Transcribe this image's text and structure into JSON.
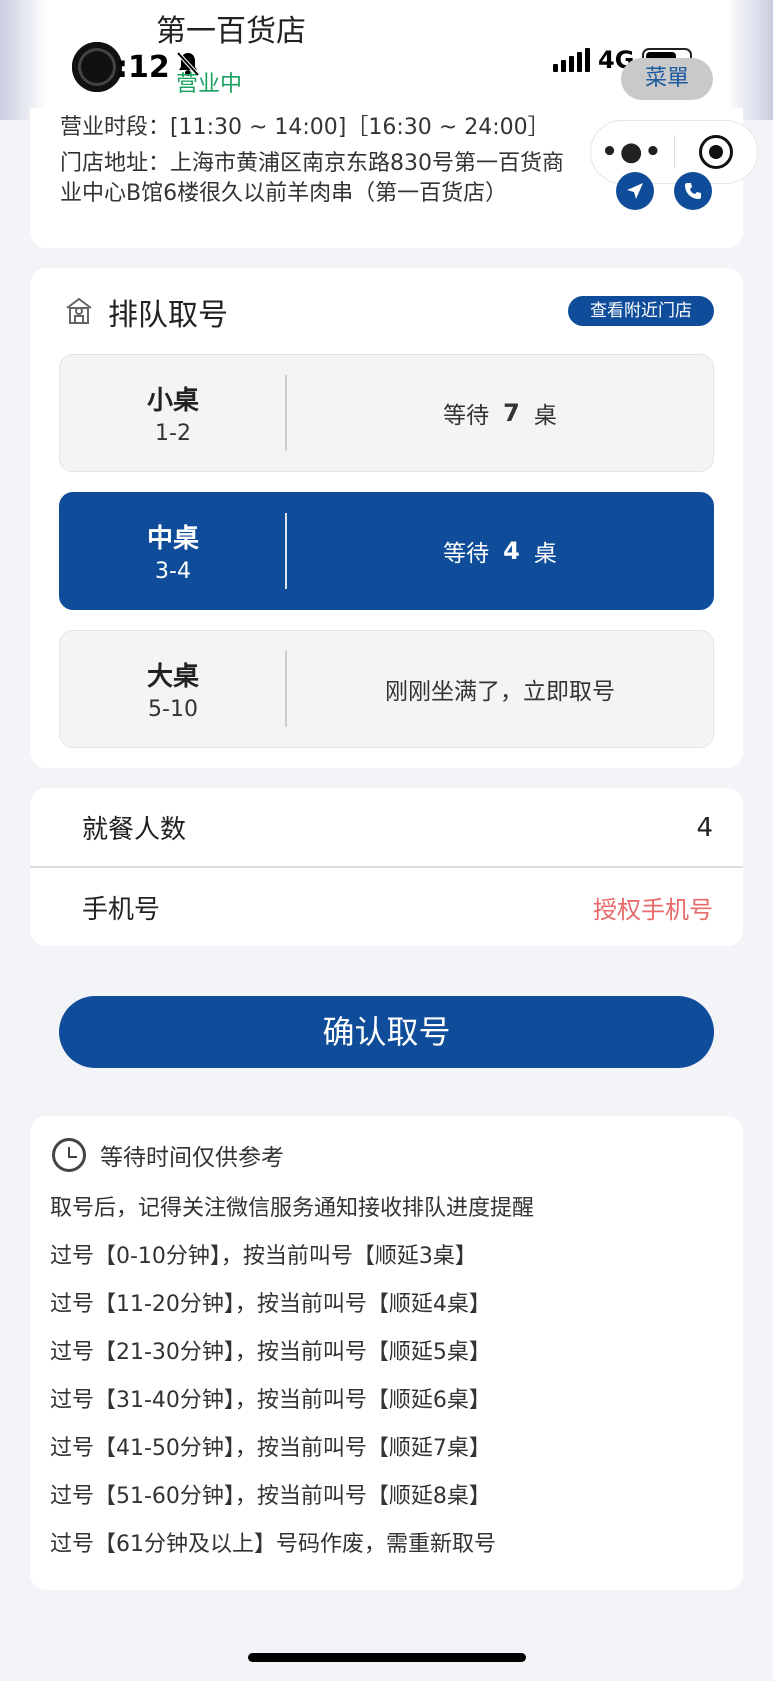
{
  "status_bar": {
    "time": ":12",
    "network": "4G"
  },
  "header": {
    "store_name": "第一百货店",
    "open_status": "营业中",
    "menu_label": "菜單"
  },
  "store_info": {
    "hours": "营业时段：[11:30 ~ 14:00]［16:30 ~ 24:00］",
    "address_line1": "门店地址：上海市黄浦区南京东路830号第一百货商",
    "address_line2": "业中心B馆6楼很久以前羊肉串（第一百货店）"
  },
  "queue": {
    "title": "排队取号",
    "nearby_button": "查看附近门店",
    "options": [
      {
        "name": "小桌",
        "range": "1-2",
        "wait_prefix": "等待",
        "wait_count": "7",
        "wait_suffix": "桌",
        "selected": false
      },
      {
        "name": "中桌",
        "range": "3-4",
        "wait_prefix": "等待",
        "wait_count": "4",
        "wait_suffix": "桌",
        "selected": true
      },
      {
        "name": "大桌",
        "range": "5-10",
        "status": "刚刚坐满了，立即取号",
        "selected": false
      }
    ]
  },
  "form": {
    "diners_label": "就餐人数",
    "diners_value": "4",
    "phone_label": "手机号",
    "phone_action": "授权手机号"
  },
  "confirm_button": "确认取号",
  "notes": {
    "title": "等待时间仅供参考",
    "lines": [
      "取号后，记得关注微信服务通知接收排队进度提醒",
      "过号【0-10分钟】，按当前叫号【顺延3桌】",
      "过号【11-20分钟】，按当前叫号【顺延4桌】",
      "过号【21-30分钟】，按当前叫号【顺延5桌】",
      "过号【31-40分钟】，按当前叫号【顺延6桌】",
      "过号【41-50分钟】，按当前叫号【顺延7桌】",
      "过号【51-60分钟】，按当前叫号【顺延8桌】",
      "过号【61分钟及以上】号码作废，需重新取号"
    ]
  },
  "colors": {
    "primary": "#0f4d9a",
    "open_green": "#1aa260",
    "auth_red": "#e86a6a"
  },
  "icons": [
    "more-dots-icon",
    "target-icon",
    "navigation-arrow-icon",
    "phone-icon",
    "store-icon",
    "clock-icon",
    "bell-off-icon",
    "signal-icon",
    "battery-icon"
  ]
}
